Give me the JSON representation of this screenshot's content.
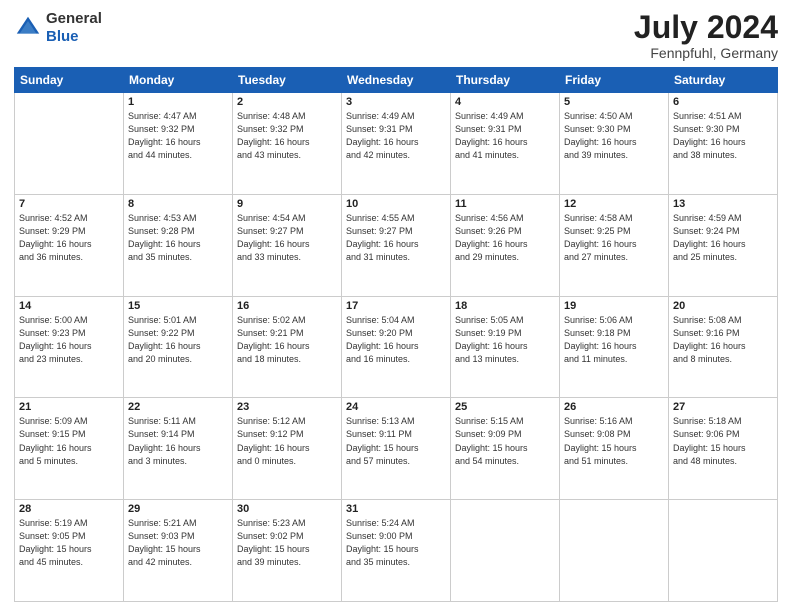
{
  "header": {
    "logo": {
      "general": "General",
      "blue": "Blue"
    },
    "month_year": "July 2024",
    "location": "Fennpfuhl, Germany"
  },
  "days_of_week": [
    "Sunday",
    "Monday",
    "Tuesday",
    "Wednesday",
    "Thursday",
    "Friday",
    "Saturday"
  ],
  "weeks": [
    [
      {
        "day": "",
        "info": ""
      },
      {
        "day": "1",
        "info": "Sunrise: 4:47 AM\nSunset: 9:32 PM\nDaylight: 16 hours\nand 44 minutes."
      },
      {
        "day": "2",
        "info": "Sunrise: 4:48 AM\nSunset: 9:32 PM\nDaylight: 16 hours\nand 43 minutes."
      },
      {
        "day": "3",
        "info": "Sunrise: 4:49 AM\nSunset: 9:31 PM\nDaylight: 16 hours\nand 42 minutes."
      },
      {
        "day": "4",
        "info": "Sunrise: 4:49 AM\nSunset: 9:31 PM\nDaylight: 16 hours\nand 41 minutes."
      },
      {
        "day": "5",
        "info": "Sunrise: 4:50 AM\nSunset: 9:30 PM\nDaylight: 16 hours\nand 39 minutes."
      },
      {
        "day": "6",
        "info": "Sunrise: 4:51 AM\nSunset: 9:30 PM\nDaylight: 16 hours\nand 38 minutes."
      }
    ],
    [
      {
        "day": "7",
        "info": "Sunrise: 4:52 AM\nSunset: 9:29 PM\nDaylight: 16 hours\nand 36 minutes."
      },
      {
        "day": "8",
        "info": "Sunrise: 4:53 AM\nSunset: 9:28 PM\nDaylight: 16 hours\nand 35 minutes."
      },
      {
        "day": "9",
        "info": "Sunrise: 4:54 AM\nSunset: 9:27 PM\nDaylight: 16 hours\nand 33 minutes."
      },
      {
        "day": "10",
        "info": "Sunrise: 4:55 AM\nSunset: 9:27 PM\nDaylight: 16 hours\nand 31 minutes."
      },
      {
        "day": "11",
        "info": "Sunrise: 4:56 AM\nSunset: 9:26 PM\nDaylight: 16 hours\nand 29 minutes."
      },
      {
        "day": "12",
        "info": "Sunrise: 4:58 AM\nSunset: 9:25 PM\nDaylight: 16 hours\nand 27 minutes."
      },
      {
        "day": "13",
        "info": "Sunrise: 4:59 AM\nSunset: 9:24 PM\nDaylight: 16 hours\nand 25 minutes."
      }
    ],
    [
      {
        "day": "14",
        "info": "Sunrise: 5:00 AM\nSunset: 9:23 PM\nDaylight: 16 hours\nand 23 minutes."
      },
      {
        "day": "15",
        "info": "Sunrise: 5:01 AM\nSunset: 9:22 PM\nDaylight: 16 hours\nand 20 minutes."
      },
      {
        "day": "16",
        "info": "Sunrise: 5:02 AM\nSunset: 9:21 PM\nDaylight: 16 hours\nand 18 minutes."
      },
      {
        "day": "17",
        "info": "Sunrise: 5:04 AM\nSunset: 9:20 PM\nDaylight: 16 hours\nand 16 minutes."
      },
      {
        "day": "18",
        "info": "Sunrise: 5:05 AM\nSunset: 9:19 PM\nDaylight: 16 hours\nand 13 minutes."
      },
      {
        "day": "19",
        "info": "Sunrise: 5:06 AM\nSunset: 9:18 PM\nDaylight: 16 hours\nand 11 minutes."
      },
      {
        "day": "20",
        "info": "Sunrise: 5:08 AM\nSunset: 9:16 PM\nDaylight: 16 hours\nand 8 minutes."
      }
    ],
    [
      {
        "day": "21",
        "info": "Sunrise: 5:09 AM\nSunset: 9:15 PM\nDaylight: 16 hours\nand 5 minutes."
      },
      {
        "day": "22",
        "info": "Sunrise: 5:11 AM\nSunset: 9:14 PM\nDaylight: 16 hours\nand 3 minutes."
      },
      {
        "day": "23",
        "info": "Sunrise: 5:12 AM\nSunset: 9:12 PM\nDaylight: 16 hours\nand 0 minutes."
      },
      {
        "day": "24",
        "info": "Sunrise: 5:13 AM\nSunset: 9:11 PM\nDaylight: 15 hours\nand 57 minutes."
      },
      {
        "day": "25",
        "info": "Sunrise: 5:15 AM\nSunset: 9:09 PM\nDaylight: 15 hours\nand 54 minutes."
      },
      {
        "day": "26",
        "info": "Sunrise: 5:16 AM\nSunset: 9:08 PM\nDaylight: 15 hours\nand 51 minutes."
      },
      {
        "day": "27",
        "info": "Sunrise: 5:18 AM\nSunset: 9:06 PM\nDaylight: 15 hours\nand 48 minutes."
      }
    ],
    [
      {
        "day": "28",
        "info": "Sunrise: 5:19 AM\nSunset: 9:05 PM\nDaylight: 15 hours\nand 45 minutes."
      },
      {
        "day": "29",
        "info": "Sunrise: 5:21 AM\nSunset: 9:03 PM\nDaylight: 15 hours\nand 42 minutes."
      },
      {
        "day": "30",
        "info": "Sunrise: 5:23 AM\nSunset: 9:02 PM\nDaylight: 15 hours\nand 39 minutes."
      },
      {
        "day": "31",
        "info": "Sunrise: 5:24 AM\nSunset: 9:00 PM\nDaylight: 15 hours\nand 35 minutes."
      },
      {
        "day": "",
        "info": ""
      },
      {
        "day": "",
        "info": ""
      },
      {
        "day": "",
        "info": ""
      }
    ]
  ]
}
